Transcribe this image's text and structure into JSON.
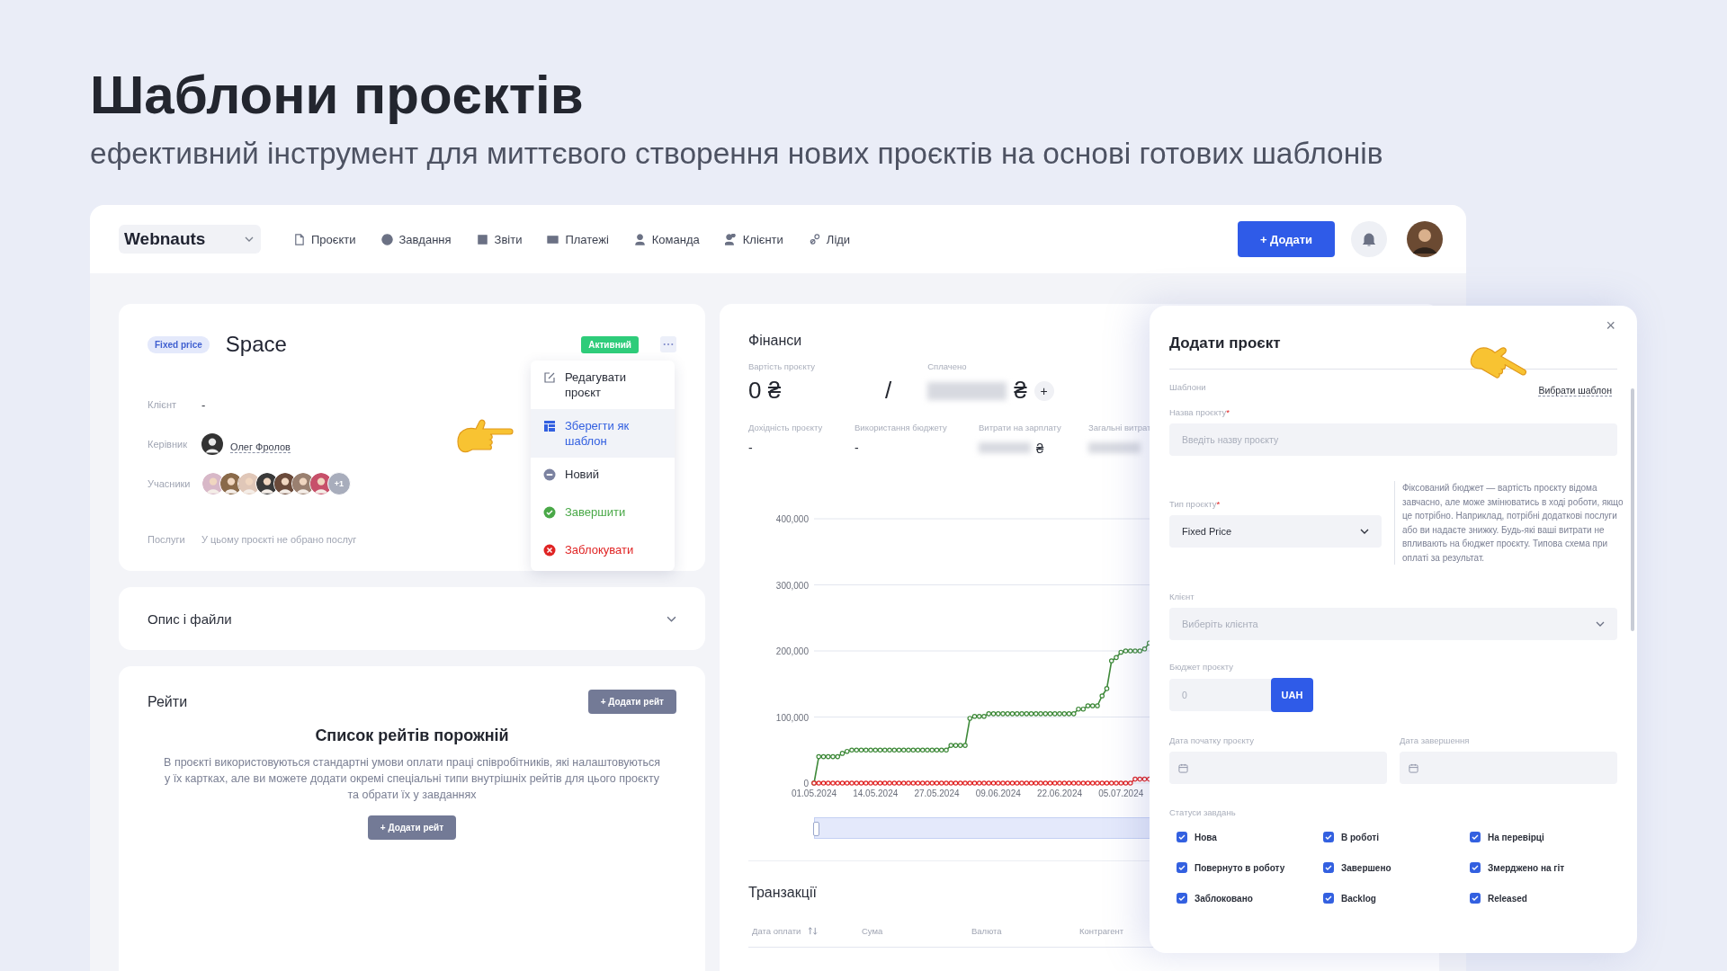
{
  "hero": {
    "title": "Шаблони проєктів",
    "subtitle": "ефективний інструмент для миттєвого створення нових проєктів на основі готових шаблонів"
  },
  "navbar": {
    "workspace": "Webnauts",
    "items": [
      {
        "label": "Проєкти"
      },
      {
        "label": "Завдання"
      },
      {
        "label": "Звіти"
      },
      {
        "label": "Платежі"
      },
      {
        "label": "Команда"
      },
      {
        "label": "Клієнти"
      },
      {
        "label": "Ліди"
      }
    ],
    "add_button": "+ Додати"
  },
  "project": {
    "type_badge": "Fixed price",
    "name": "Space",
    "status": "Активний",
    "fields": [
      {
        "kind": "text",
        "label": "Клієнт",
        "value": "-"
      },
      {
        "kind": "person",
        "label": "Керівник",
        "value": "Олег Фролов"
      },
      {
        "kind": "avatars",
        "label": "Учасники",
        "extra": "+1"
      },
      {
        "kind": "muted",
        "label": "Послуги",
        "value": "У цьому проєкті не обрано послуг"
      }
    ],
    "menu": [
      {
        "kind": "edit",
        "label": "Редагувати проєкт",
        "selected": false
      },
      {
        "kind": "template",
        "label": "Зберегти як шаблон",
        "selected": true
      },
      {
        "kind": "new",
        "label": "Новий",
        "selected": false
      },
      {
        "kind": "complete",
        "label": "Завершити",
        "selected": false
      },
      {
        "kind": "block",
        "label": "Заблокувати",
        "selected": false
      }
    ]
  },
  "description_panel": {
    "title": "Опис і файли",
    "expanded": false
  },
  "rates": {
    "title": "Рейти",
    "add_button": "+ Додати рейт",
    "empty_title": "Список рейтів порожній",
    "empty_text": "В проєкті використовуються стандартні умови оплати праці співробітників, які налаштовуються у їх картках, але ви можете додати окремі спеціальні типи внутрішніх рейтів для цього проєкту та обрати їх у завданнях",
    "empty_button": "+ Додати рейт"
  },
  "finance": {
    "title": "Фінанси",
    "cost_label": "Вартість проєкту",
    "cost_value": "0 ₴",
    "separator": "/",
    "paid_label": "Сплачено",
    "paid_currency": "₴",
    "paid_add": "+",
    "stats": [
      {
        "label": "Дохідність проєкту",
        "value": "-",
        "blurred": false
      },
      {
        "label": "Використання бюджету",
        "value": "-",
        "blurred": false
      },
      {
        "label": "Витрати на зарплату",
        "currency": "₴",
        "blurred": true
      },
      {
        "label": "Загальні витрат",
        "blurred": true
      }
    ],
    "chart_data": {
      "type": "line",
      "grid": true,
      "ylim": [
        0,
        400000
      ],
      "categories": [
        "01.05.2024",
        null,
        null,
        null,
        null,
        null,
        null,
        null,
        null,
        null,
        null,
        null,
        null,
        "14.05.2024",
        null,
        null,
        null,
        null,
        null,
        null,
        null,
        null,
        null,
        null,
        null,
        null,
        "27.05.2024",
        null,
        null,
        null,
        null,
        null,
        null,
        null,
        null,
        null,
        null,
        null,
        null,
        "09.06.2024",
        null,
        null,
        null,
        null,
        null,
        null,
        null,
        null,
        null,
        null,
        null,
        null,
        "22.06.2024",
        null,
        null,
        null,
        null,
        null,
        null,
        null,
        null,
        null,
        null,
        null,
        null,
        "05.07.2024",
        null,
        null,
        null,
        null,
        null,
        null
      ],
      "yticks": [
        {
          "value": 0,
          "label": "0"
        },
        {
          "value": 100000,
          "label": "100,000"
        },
        {
          "value": 200000,
          "label": "200,000"
        },
        {
          "value": 300000,
          "label": "300,000"
        },
        {
          "value": 400000,
          "label": "400,000"
        }
      ],
      "series": [
        {
          "color": "#3f8a3a",
          "marker": "circle",
          "values": [
            0,
            40000,
            40000,
            40000,
            40000,
            40000,
            45000,
            48000,
            50000,
            50000,
            50000,
            50000,
            50000,
            50000,
            50000,
            50000,
            50000,
            50000,
            50000,
            50000,
            50000,
            50000,
            50000,
            50000,
            50000,
            50000,
            50000,
            50000,
            50000,
            57000,
            57000,
            57000,
            57000,
            98000,
            101000,
            101000,
            101000,
            105000,
            105000,
            105000,
            105000,
            105000,
            105000,
            105000,
            105000,
            105000,
            105000,
            105000,
            105000,
            105000,
            105000,
            105000,
            105000,
            105000,
            105000,
            105000,
            112000,
            112000,
            117000,
            117000,
            117000,
            132000,
            143000,
            185000,
            190000,
            198000,
            200000,
            200000,
            200000,
            200000,
            203000,
            212000
          ]
        },
        {
          "color": "#e02424",
          "marker": "circle",
          "values": [
            0,
            0,
            0,
            0,
            0,
            0,
            0,
            0,
            0,
            0,
            0,
            0,
            0,
            0,
            0,
            0,
            0,
            0,
            0,
            0,
            0,
            0,
            0,
            0,
            0,
            0,
            0,
            0,
            0,
            0,
            0,
            0,
            0,
            0,
            0,
            0,
            0,
            0,
            0,
            0,
            0,
            0,
            0,
            0,
            0,
            0,
            0,
            0,
            0,
            0,
            0,
            0,
            0,
            0,
            0,
            0,
            0,
            0,
            0,
            0,
            0,
            0,
            0,
            0,
            0,
            0,
            0,
            0,
            6000,
            6000,
            6000,
            6000
          ]
        }
      ]
    }
  },
  "transactions": {
    "title": "Транзакції",
    "columns": [
      {
        "label": "Дата оплати",
        "sortable": true
      },
      {
        "label": "Сума",
        "sortable": false
      },
      {
        "label": "Валюта",
        "sortable": false
      },
      {
        "label": "Контрагент",
        "sortable": false
      }
    ]
  },
  "modal": {
    "title": "Додати проєкт",
    "close": "×",
    "templates_label": "Шаблони",
    "templates_link": "Вибрати шаблон",
    "name_field": {
      "label": "Назва проєкту",
      "required_mark": "*",
      "placeholder": "Введіть назву проєкту"
    },
    "type_field": {
      "label": "Тип проєкту",
      "required_mark": "*",
      "value": "Fixed Price",
      "hint": "Фіксований бюджет — вартість проєкту відома завчасно, але може змінюватись в ході роботи, якщо це потрібно. Наприклад, потрібні додаткові послуги або ви надаєте знижку. Будь-які ваші витрати не впливають на бюджет проєкту. Типова схема при оплаті за результат."
    },
    "client_field": {
      "label": "Клієнт",
      "placeholder": "Виберіть клієнта"
    },
    "budget_field": {
      "label": "Бюджет проєкту",
      "placeholder": "0",
      "currency": "UAH"
    },
    "start_date": {
      "label": "Дата початку проєкту"
    },
    "end_date": {
      "label": "Дата завершення"
    },
    "statuses": {
      "label": "Статуси завдань",
      "items": [
        {
          "label": "Нова",
          "checked": true
        },
        {
          "label": "В роботі",
          "checked": true
        },
        {
          "label": "На перевірці",
          "checked": true
        },
        {
          "label": "Повернуто в роботу",
          "checked": true
        },
        {
          "label": "Завершено",
          "checked": true
        },
        {
          "label": "Змерджено на гіт",
          "checked": true
        },
        {
          "label": "Заблоковано",
          "checked": true
        },
        {
          "label": "Backlog",
          "checked": true
        },
        {
          "label": "Released",
          "checked": true
        }
      ]
    }
  }
}
